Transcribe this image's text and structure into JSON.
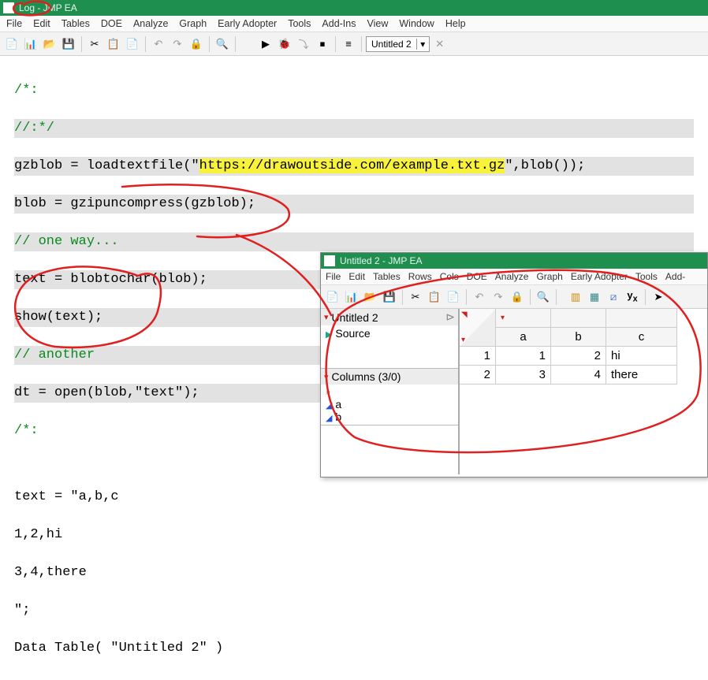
{
  "main": {
    "title": "Log - JMP EA",
    "menu": [
      "File",
      "Edit",
      "Tables",
      "DOE",
      "Analyze",
      "Graph",
      "Early Adopter",
      "Tools",
      "Add-Ins",
      "View",
      "Window",
      "Help"
    ],
    "combo_label": "Untitled 2"
  },
  "code": {
    "c1": "/*:",
    "c2": "//:*/",
    "l1a": "gzblob = loadtextfile(",
    "l1b": "\"",
    "l1url": "https://drawoutside.com/example.txt.gz",
    "l1c": "\"",
    "l1d": ",blob());",
    "l2": "blob = gzipuncompress(gzblob);",
    "c3": "// one way...",
    "l3": "text = blobtochar(blob);",
    "l4": "show(text);",
    "c4": "// another",
    "l5": "dt = open(blob,\"text\");",
    "c5": "/*:"
  },
  "log": {
    "l1": "text = \"a,b,c",
    "l2": "1,2,hi",
    "l3": "3,4,there",
    "l4": "\";",
    "l5": "Data Table( \"Untitled 2\" )"
  },
  "inner": {
    "title": "Untitled 2 - JMP EA",
    "menu": [
      "File",
      "Edit",
      "Tables",
      "Rows",
      "Cols",
      "DOE",
      "Analyze",
      "Graph",
      "Early Adopter",
      "Tools",
      "Add-"
    ],
    "panel_name": "Untitled 2",
    "source_label": "Source",
    "cols_panel": "Columns (3/0)",
    "col_a": "a",
    "col_b": "b",
    "headers": [
      "a",
      "b",
      "c"
    ],
    "rows": [
      {
        "n": "1",
        "a": "1",
        "b": "2",
        "c": "hi"
      },
      {
        "n": "2",
        "a": "3",
        "b": "4",
        "c": "there"
      }
    ]
  }
}
